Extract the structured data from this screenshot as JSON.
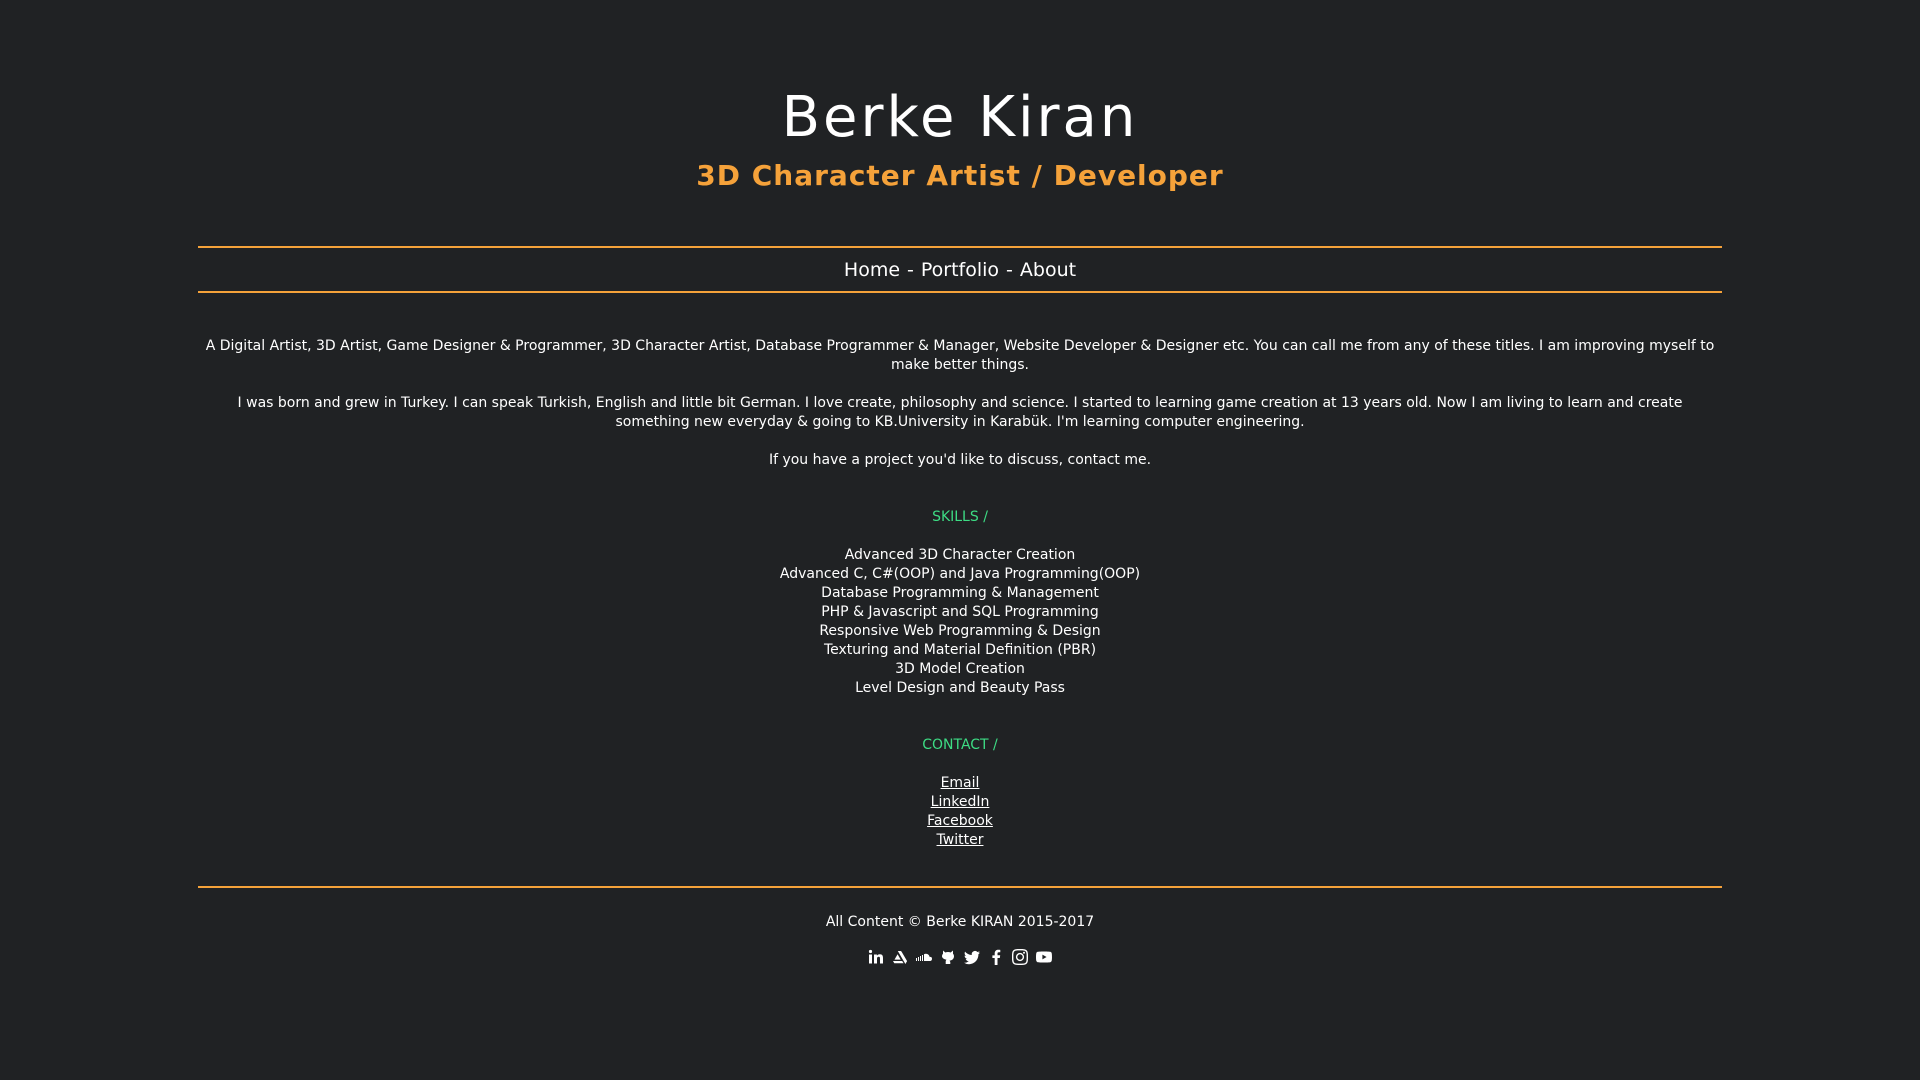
{
  "header": {
    "title": "Berke Kiran",
    "subtitle": "3D Character Artist / Developer"
  },
  "nav": {
    "items": [
      "Home",
      "Portfolio",
      "About"
    ],
    "separator": "-"
  },
  "about": {
    "paragraphs": [
      "A Digital Artist, 3D Artist, Game Designer & Programmer, 3D Character Artist, Database Programmer & Manager, Website Developer & Designer etc. You can call me from any of these titles. I am improving myself to make better things.",
      "I was born and grew in Turkey. I can speak Turkish, English and little bit German. I love create, philosophy and science. I started to learning game creation at 13 years old. Now I am living to learn and create something new everyday & going to KB.University in Karabük. I'm learning computer engineering.",
      "If you have a project you'd like to discuss, contact me."
    ]
  },
  "skills": {
    "title": "SKILLS /",
    "items": [
      "Advanced 3D Character Creation",
      "Advanced C, C#(OOP) and Java Programming(OOP)",
      "Database Programming & Management",
      "PHP & Javascript and SQL Programming",
      "Responsive Web Programming & Design",
      "Texturing and Material Definition (PBR)",
      "3D Model Creation",
      "Level Design and Beauty Pass"
    ]
  },
  "contact": {
    "title": "CONTACT /",
    "links": [
      "Email",
      "LinkedIn",
      "Facebook",
      "Twitter"
    ]
  },
  "footer": {
    "copyright": "All Content © Berke KIRAN 2015-2017",
    "social_icons": [
      "linkedin-icon",
      "artstation-icon",
      "soundcloud-icon",
      "github-icon",
      "twitter-icon",
      "facebook-icon",
      "instagram-icon",
      "youtube-icon"
    ]
  },
  "colors": {
    "background": "#202224",
    "accent": "#f5a23a",
    "section_title": "#3ddc84",
    "text": "#ffffff"
  }
}
